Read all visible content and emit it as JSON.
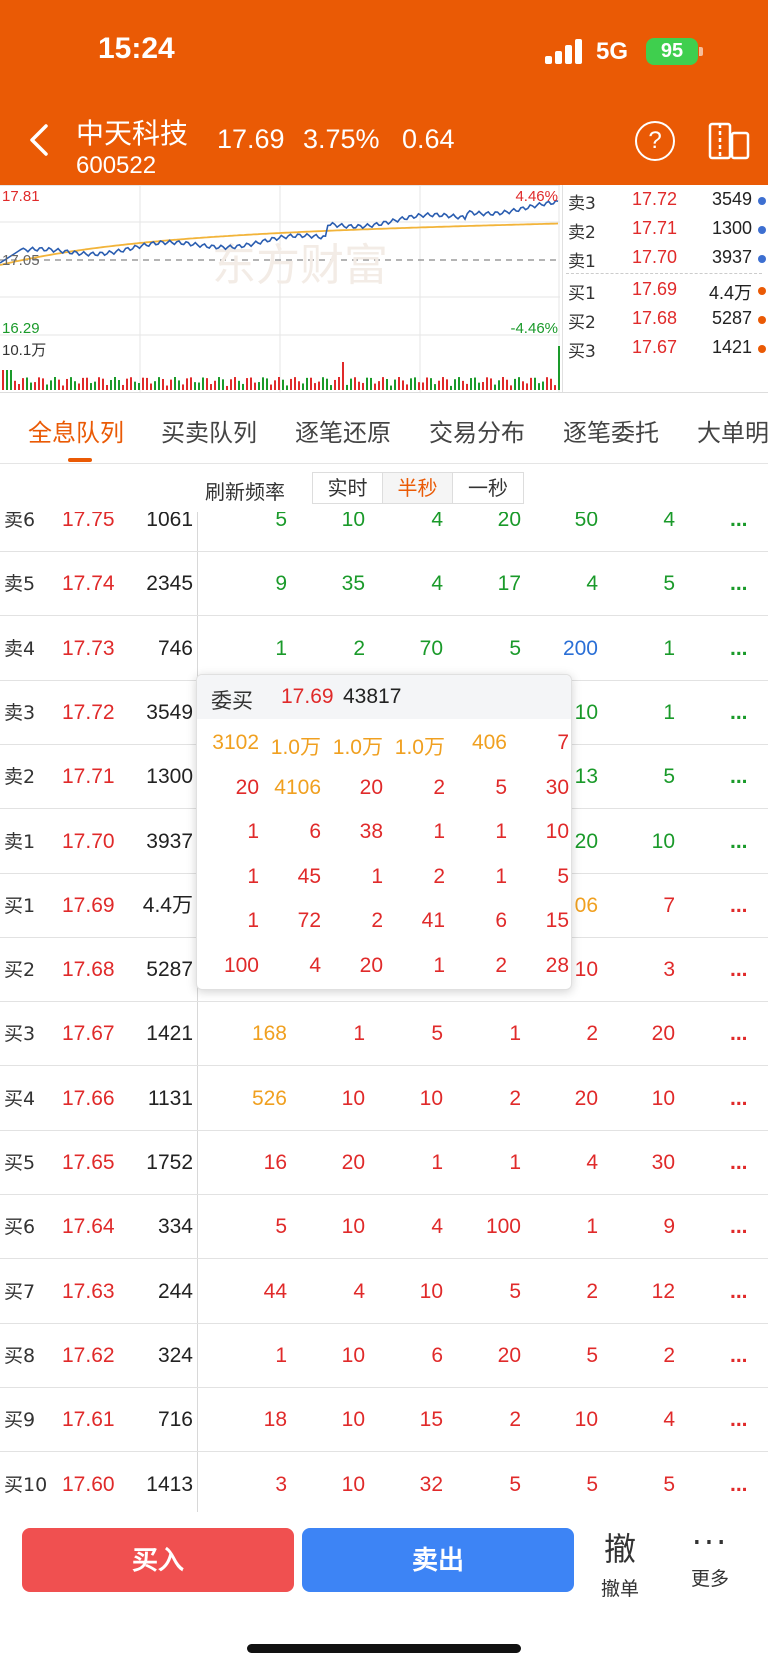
{
  "status": {
    "time": "15:24",
    "network": "5G",
    "battery": "95"
  },
  "stock": {
    "name": "中天科技",
    "code": "600522",
    "price": "17.69",
    "change_pct": "3.75%",
    "change": "0.64"
  },
  "header": {
    "help_label": "?"
  },
  "chart": {
    "high_label": "17.81",
    "mid_label": "17.05",
    "low_label": "16.29",
    "up_pct": "4.46%",
    "down_pct": "-4.46%",
    "volume_label": "10.1万",
    "watermark": "东方财富",
    "colors": {
      "price_line": "#2a5db0",
      "avg_line": "#f2b43a",
      "up": "#e02a2a",
      "down": "#1a9a2a"
    }
  },
  "orderbook": [
    {
      "label": "卖3",
      "price": "17.72",
      "vol": "3549",
      "dot": "#3d6fd1"
    },
    {
      "label": "卖2",
      "price": "17.71",
      "vol": "1300",
      "dot": "#3d6fd1"
    },
    {
      "label": "卖1",
      "price": "17.70",
      "vol": "3937",
      "dot": "#3d6fd1"
    },
    {
      "label": "买1",
      "price": "17.69",
      "vol": "4.4万",
      "dot": "#ea5a05"
    },
    {
      "label": "买2",
      "price": "17.68",
      "vol": "5287",
      "dot": "#ea5a05"
    },
    {
      "label": "买3",
      "price": "17.67",
      "vol": "1421",
      "dot": "#ea5a05"
    }
  ],
  "tabs": [
    "全息队列",
    "买卖队列",
    "逐笔还原",
    "交易分布",
    "逐笔委托",
    "大单明"
  ],
  "freq": {
    "label": "刷新频率",
    "options": [
      "实时",
      "半秒",
      "一秒"
    ]
  },
  "queue_more": "...",
  "queue": [
    {
      "label": "卖6",
      "price": "17.75",
      "vol": "1061",
      "side": "ask",
      "cells": [
        [
          "5",
          "g"
        ],
        [
          "10",
          "g"
        ],
        [
          "4",
          "g"
        ],
        [
          "20",
          "g"
        ],
        [
          "50",
          "g"
        ],
        [
          "4",
          "g"
        ]
      ]
    },
    {
      "label": "卖5",
      "price": "17.74",
      "vol": "2345",
      "side": "ask",
      "cells": [
        [
          "9",
          "g"
        ],
        [
          "35",
          "g"
        ],
        [
          "4",
          "g"
        ],
        [
          "17",
          "g"
        ],
        [
          "4",
          "g"
        ],
        [
          "5",
          "g"
        ]
      ]
    },
    {
      "label": "卖4",
      "price": "17.73",
      "vol": "746",
      "side": "ask",
      "cells": [
        [
          "1",
          "g"
        ],
        [
          "2",
          "g"
        ],
        [
          "70",
          "g"
        ],
        [
          "5",
          "g"
        ],
        [
          "200",
          "b"
        ],
        [
          "1",
          "g"
        ]
      ]
    },
    {
      "label": "卖3",
      "price": "17.72",
      "vol": "3549",
      "side": "ask",
      "cells": [
        [
          "",
          "g"
        ],
        [
          "",
          "g"
        ],
        [
          "",
          "g"
        ],
        [
          "",
          "g"
        ],
        [
          "10",
          "g"
        ],
        [
          "1",
          "g"
        ]
      ]
    },
    {
      "label": "卖2",
      "price": "17.71",
      "vol": "1300",
      "side": "ask",
      "cells": [
        [
          "",
          "g"
        ],
        [
          "",
          "g"
        ],
        [
          "",
          "g"
        ],
        [
          "",
          "g"
        ],
        [
          "13",
          "g"
        ],
        [
          "5",
          "g"
        ]
      ]
    },
    {
      "label": "卖1",
      "price": "17.70",
      "vol": "3937",
      "side": "ask",
      "cells": [
        [
          "",
          "g"
        ],
        [
          "",
          "g"
        ],
        [
          "",
          "g"
        ],
        [
          "",
          "g"
        ],
        [
          "20",
          "g"
        ],
        [
          "10",
          "g"
        ]
      ]
    },
    {
      "label": "买1",
      "price": "17.69",
      "vol": "4.4万",
      "side": "bid",
      "cells": [
        [
          "",
          "r"
        ],
        [
          "",
          "r"
        ],
        [
          "",
          "r"
        ],
        [
          "",
          "r"
        ],
        [
          "06",
          "o"
        ],
        [
          "7",
          "r"
        ]
      ]
    },
    {
      "label": "买2",
      "price": "17.68",
      "vol": "5287",
      "side": "bid",
      "cells": [
        [
          "",
          "r"
        ],
        [
          "",
          "r"
        ],
        [
          "",
          "r"
        ],
        [
          "",
          "r"
        ],
        [
          "10",
          "r"
        ],
        [
          "3",
          "r"
        ]
      ]
    },
    {
      "label": "买3",
      "price": "17.67",
      "vol": "1421",
      "side": "bid",
      "cells": [
        [
          "168",
          "o"
        ],
        [
          "1",
          "r"
        ],
        [
          "5",
          "r"
        ],
        [
          "1",
          "r"
        ],
        [
          "2",
          "r"
        ],
        [
          "20",
          "r"
        ]
      ]
    },
    {
      "label": "买4",
      "price": "17.66",
      "vol": "1131",
      "side": "bid",
      "cells": [
        [
          "526",
          "o"
        ],
        [
          "10",
          "r"
        ],
        [
          "10",
          "r"
        ],
        [
          "2",
          "r"
        ],
        [
          "20",
          "r"
        ],
        [
          "10",
          "r"
        ]
      ]
    },
    {
      "label": "买5",
      "price": "17.65",
      "vol": "1752",
      "side": "bid",
      "cells": [
        [
          "16",
          "r"
        ],
        [
          "20",
          "r"
        ],
        [
          "1",
          "r"
        ],
        [
          "1",
          "r"
        ],
        [
          "4",
          "r"
        ],
        [
          "30",
          "r"
        ]
      ]
    },
    {
      "label": "买6",
      "price": "17.64",
      "vol": "334",
      "side": "bid",
      "cells": [
        [
          "5",
          "r"
        ],
        [
          "10",
          "r"
        ],
        [
          "4",
          "r"
        ],
        [
          "100",
          "r"
        ],
        [
          "1",
          "r"
        ],
        [
          "9",
          "r"
        ]
      ]
    },
    {
      "label": "买7",
      "price": "17.63",
      "vol": "244",
      "side": "bid",
      "cells": [
        [
          "44",
          "r"
        ],
        [
          "4",
          "r"
        ],
        [
          "10",
          "r"
        ],
        [
          "5",
          "r"
        ],
        [
          "2",
          "r"
        ],
        [
          "12",
          "r"
        ]
      ]
    },
    {
      "label": "买8",
      "price": "17.62",
      "vol": "324",
      "side": "bid",
      "cells": [
        [
          "1",
          "r"
        ],
        [
          "10",
          "r"
        ],
        [
          "6",
          "r"
        ],
        [
          "20",
          "r"
        ],
        [
          "5",
          "r"
        ],
        [
          "2",
          "r"
        ]
      ]
    },
    {
      "label": "买9",
      "price": "17.61",
      "vol": "716",
      "side": "bid",
      "cells": [
        [
          "18",
          "r"
        ],
        [
          "10",
          "r"
        ],
        [
          "15",
          "r"
        ],
        [
          "2",
          "r"
        ],
        [
          "10",
          "r"
        ],
        [
          "4",
          "r"
        ]
      ]
    },
    {
      "label": "买10",
      "price": "17.60",
      "vol": "1413",
      "side": "bid",
      "cells": [
        [
          "3",
          "r"
        ],
        [
          "10",
          "r"
        ],
        [
          "32",
          "r"
        ],
        [
          "5",
          "r"
        ],
        [
          "5",
          "r"
        ],
        [
          "5",
          "r"
        ]
      ]
    }
  ],
  "popup": {
    "title": "委买",
    "price": "17.69",
    "total": "43817",
    "rows": [
      [
        [
          "3102",
          "o"
        ],
        [
          "1.0万",
          "o"
        ],
        [
          "1.0万",
          "o"
        ],
        [
          "1.0万",
          "o"
        ],
        [
          "406",
          "o"
        ],
        [
          "7",
          "r"
        ]
      ],
      [
        [
          "20",
          "r"
        ],
        [
          "4106",
          "o"
        ],
        [
          "20",
          "r"
        ],
        [
          "2",
          "r"
        ],
        [
          "5",
          "r"
        ],
        [
          "30",
          "r"
        ]
      ],
      [
        [
          "1",
          "r"
        ],
        [
          "6",
          "r"
        ],
        [
          "38",
          "r"
        ],
        [
          "1",
          "r"
        ],
        [
          "1",
          "r"
        ],
        [
          "10",
          "r"
        ]
      ],
      [
        [
          "1",
          "r"
        ],
        [
          "45",
          "r"
        ],
        [
          "1",
          "r"
        ],
        [
          "2",
          "r"
        ],
        [
          "1",
          "r"
        ],
        [
          "5",
          "r"
        ]
      ],
      [
        [
          "1",
          "r"
        ],
        [
          "72",
          "r"
        ],
        [
          "2",
          "r"
        ],
        [
          "41",
          "r"
        ],
        [
          "6",
          "r"
        ],
        [
          "15",
          "r"
        ]
      ],
      [
        [
          "100",
          "r"
        ],
        [
          "4",
          "r"
        ],
        [
          "20",
          "r"
        ],
        [
          "1",
          "r"
        ],
        [
          "2",
          "r"
        ],
        [
          "28",
          "r"
        ]
      ]
    ]
  },
  "bottom": {
    "buy": "买入",
    "sell": "卖出",
    "cancel_big": "撤",
    "cancel": "撤单",
    "more_dots": "···",
    "more": "更多"
  },
  "palette": {
    "g": "#1a9a2a",
    "r": "#e02a2a",
    "o": "#f0a020",
    "b": "#2a6fd6"
  }
}
